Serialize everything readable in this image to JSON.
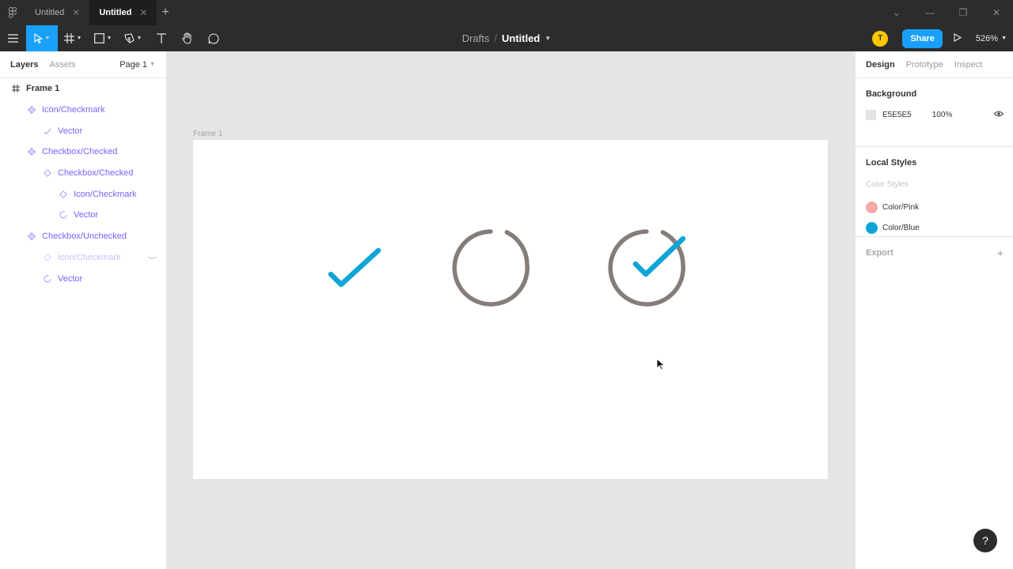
{
  "tabs": [
    {
      "label": "Untitled",
      "close": "✕"
    },
    {
      "label": "Untitled",
      "close": "✕"
    }
  ],
  "breadcrumb": {
    "parent": "Drafts",
    "separator": "/",
    "title": "Untitled"
  },
  "toolbar_right": {
    "avatar_letter": "T",
    "share_label": "Share",
    "zoom": "526%"
  },
  "left_panel": {
    "tab_layers": "Layers",
    "tab_assets": "Assets",
    "page": "Page 1",
    "layers": [
      {
        "name": "Frame 1",
        "icon": "frame-icon"
      },
      {
        "name": "Icon/Checkmark",
        "icon": "component-icon"
      },
      {
        "name": "Vector",
        "icon": "vector-check-icon"
      },
      {
        "name": "Checkbox/Checked",
        "icon": "component-icon"
      },
      {
        "name": "Checkbox/Checked",
        "icon": "instance-icon"
      },
      {
        "name": "Icon/Checkmark",
        "icon": "instance-icon"
      },
      {
        "name": "Vector",
        "icon": "vector-arc-icon"
      },
      {
        "name": "Checkbox/Unchecked",
        "icon": "component-icon"
      },
      {
        "name": "Icon/Checkmark",
        "icon": "instance-icon"
      },
      {
        "name": "Vector",
        "icon": "vector-arc-icon"
      }
    ]
  },
  "canvas": {
    "frame_label": "Frame 1"
  },
  "right_panel": {
    "tab_design": "Design",
    "tab_prototype": "Prototype",
    "tab_inspect": "Inspect",
    "background": {
      "title": "Background",
      "hex": "E5E5E5",
      "opacity": "100%"
    },
    "local_styles": {
      "title": "Local Styles",
      "subtitle": "Color Styles",
      "styles": [
        {
          "name": "Color/Pink",
          "color": "#f4a9a8"
        },
        {
          "name": "Color/Blue",
          "color": "#0fa5d6"
        }
      ]
    },
    "export_title": "Export"
  },
  "help_label": "?",
  "colors": {
    "accent": "#18a0fb",
    "check_blue": "#0fa5d6",
    "ring_gray": "#857d79",
    "component_purple": "#7b61ff"
  }
}
